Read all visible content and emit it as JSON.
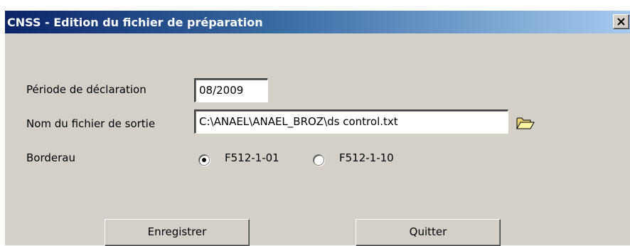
{
  "window": {
    "title": "CNSS - Edition du fichier de préparation",
    "close_label": "X"
  },
  "form": {
    "period_label": "Période de déclaration",
    "period_value": "08/2009",
    "output_file_label": "Nom du fichier de sortie",
    "output_file_value": "C:\\ANAEL\\ANAEL_BROZ\\ds control.txt",
    "browse_icon": "folder-open-icon",
    "borderau_label": "Borderau",
    "radio_options": [
      {
        "label": "F512-1-01",
        "selected": true
      },
      {
        "label": "F512-1-10",
        "selected": false
      }
    ]
  },
  "buttons": {
    "save_label": "Enregistrer",
    "quit_label": "Quitter"
  },
  "colors": {
    "title_gradient_start": "#0a246a",
    "title_gradient_end": "#a6caf0",
    "window_bg": "#d4d0c8"
  }
}
